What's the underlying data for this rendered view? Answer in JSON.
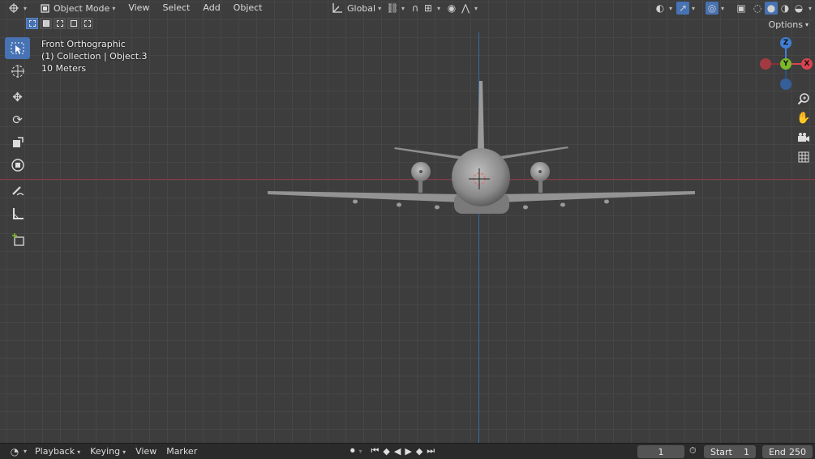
{
  "header": {
    "editor_type_icon": "globe-cursor-icon",
    "mode": "Object Mode",
    "menus": [
      "View",
      "Select",
      "Add",
      "Object"
    ],
    "transform_orientation": "Global",
    "options": "Options"
  },
  "overlay_info": {
    "view_name": "Front Orthographic",
    "collection": "(1) Collection | Object.3",
    "scale": "10 Meters"
  },
  "gizmo": {
    "z": "Z",
    "y": "Y",
    "x": "X"
  },
  "toolbar": [
    "select-box",
    "cursor",
    "move",
    "rotate",
    "scale",
    "transform",
    "annotate",
    "measure",
    "add-cube"
  ],
  "timeline": {
    "menus": [
      "Playback",
      "Keying",
      "View",
      "Marker"
    ],
    "current_frame": "1",
    "start_label": "Start",
    "start_value": "1",
    "end_label": "End",
    "end_value": "250"
  },
  "colors": {
    "accent": "#4772b3",
    "x_axis": "#d9434f",
    "y_axis": "#7bb82a",
    "z_axis": "#3f7fd4"
  }
}
